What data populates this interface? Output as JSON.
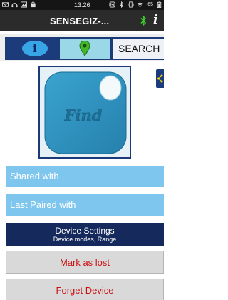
{
  "status_bar": {
    "time": "13:26",
    "signal_text": "-65",
    "left_icons": [
      "mail-icon",
      "headset-icon",
      "image-icon",
      "shopping-icon"
    ],
    "right_icons": [
      "nfc-icon",
      "bluetooth-icon",
      "vibrate-icon",
      "wifi-icon",
      "battery-icon"
    ]
  },
  "app_bar": {
    "title": "SENSEGIZ-...",
    "bluetooth_icon": "bluetooth-icon",
    "info_icon": "info-icon"
  },
  "tabs": {
    "info_glyph": "i",
    "map_icon": "map-pin-icon",
    "search_label": "SEARCH"
  },
  "tag": {
    "image_text": "Find",
    "color": "#2f8fbf"
  },
  "menu": {
    "shared_with": "Shared with",
    "last_paired_with": "Last Paired with",
    "device_settings_title": "Device Settings",
    "device_settings_subtitle": "Device modes, Range",
    "mark_as_lost": "Mark as lost",
    "forget_device": "Forget Device"
  },
  "colors": {
    "accent_dark": "#1c3b7b",
    "row_light": "#7ec6ee",
    "danger_text": "#cc1010"
  }
}
